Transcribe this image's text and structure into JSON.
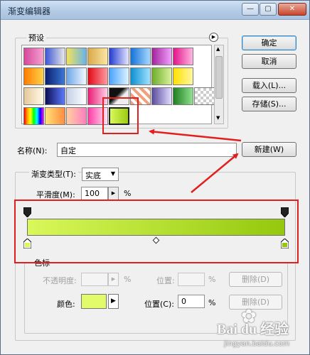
{
  "window": {
    "title": "渐变编辑器",
    "min": "—",
    "max": "▢",
    "close": "✕"
  },
  "presets": {
    "label": "预设",
    "menu_icon": "circle-arrow-icon",
    "swatches": [
      [
        "linear-gradient(90deg,#d6479a,#f4a2d0)",
        "linear-gradient(90deg,#3b57d6,#e8e8e8)",
        "linear-gradient(90deg,#f3e25a,#67b5e8)",
        "linear-gradient(90deg,#d8a94c,#fbe6a1)",
        "linear-gradient(90deg,#243dd0,#e6e6ff)",
        "linear-gradient(90deg,#1572d6,#a6d8ff)",
        "linear-gradient(90deg,#a3249b,#f2a0ff)",
        "linear-gradient(90deg,#e4148a,#ffb6e1)"
      ],
      [
        "linear-gradient(90deg,#ff7b00,#ffd24a)",
        "linear-gradient(90deg,#0a1f6e,#3c78d8)",
        "linear-gradient(90deg,#6ea7e8,#f3f9ff)",
        "linear-gradient(90deg,#e30b18,#ff9aa0)",
        "linear-gradient(90deg,#4aa3ff,#e0f4ff)",
        "linear-gradient(90deg,#0c8fd1,#9fe3ff)",
        "linear-gradient(90deg,#6fae2d,#d9f29b)",
        "linear-gradient(90deg,#ffe000,#fff7a0)"
      ],
      [
        "linear-gradient(90deg,#e6c79a,#fffbe8)",
        "linear-gradient(90deg,#0d0f55,#5c7aff)",
        "linear-gradient(90deg,#c4d0e8,#ffffff)",
        "linear-gradient(90deg,#e91e78,#ffd0e6)",
        "linear-gradient(135deg,#111 40%,#777 50%,#eee 60%)",
        "repeating-linear-gradient(45deg,#f3a07a 0 4px,#fff 4px 8px)",
        "linear-gradient(90deg,#5b4c9d,#e2ddff)",
        "linear-gradient(90deg,#1f7e1f,#8fe38f)",
        "repeating-conic-gradient(#ccc 0 25%,#fff 0 50%) 0 0/8px 8px"
      ],
      [
        "linear-gradient(90deg,red,orange,yellow,lime,cyan,blue,magenta)",
        "linear-gradient(90deg,#ffe17a,#ff8c3c)",
        "linear-gradient(90deg,#ffd0a0,#ff7fbf)",
        "linear-gradient(90deg,#ff3ca5,#ffe3f3)",
        "linear-gradient(90deg,#d9f85a,#9ccc13)"
      ]
    ],
    "selected": "linear-gradient(90deg,#d9f85a,#9ccc13)"
  },
  "buttons": {
    "ok": "确定",
    "cancel": "取消",
    "load": "载入(L)...",
    "save": "存储(S)...",
    "new": "新建(W)"
  },
  "name_field": {
    "label": "名称(N):",
    "value": "自定"
  },
  "gradient": {
    "type_label": "渐变类型(T):",
    "type_value": "实底",
    "smoothness_label": "平滑度(M):",
    "smoothness_value": "100",
    "smoothness_unit": "%",
    "start_color": "#d9f85a",
    "end_color": "#94c80d",
    "midpoint": 0.5
  },
  "stops": {
    "label": "色标",
    "opacity_label": "不透明度:",
    "opacity_unit": "%",
    "position_label_disabled": "位置:",
    "position_unit_disabled": "%",
    "delete_label_disabled": "删除(D)",
    "color_label": "颜色:",
    "color_value": "#e2fb6a",
    "position_label": "位置(C):",
    "position_value": "0",
    "position_unit": "%",
    "delete_label": "删除(D)"
  },
  "watermark": {
    "brand": "Bai du 经验",
    "url": "jingyan.baidu.com"
  },
  "annotation_color": "#e31e1e"
}
